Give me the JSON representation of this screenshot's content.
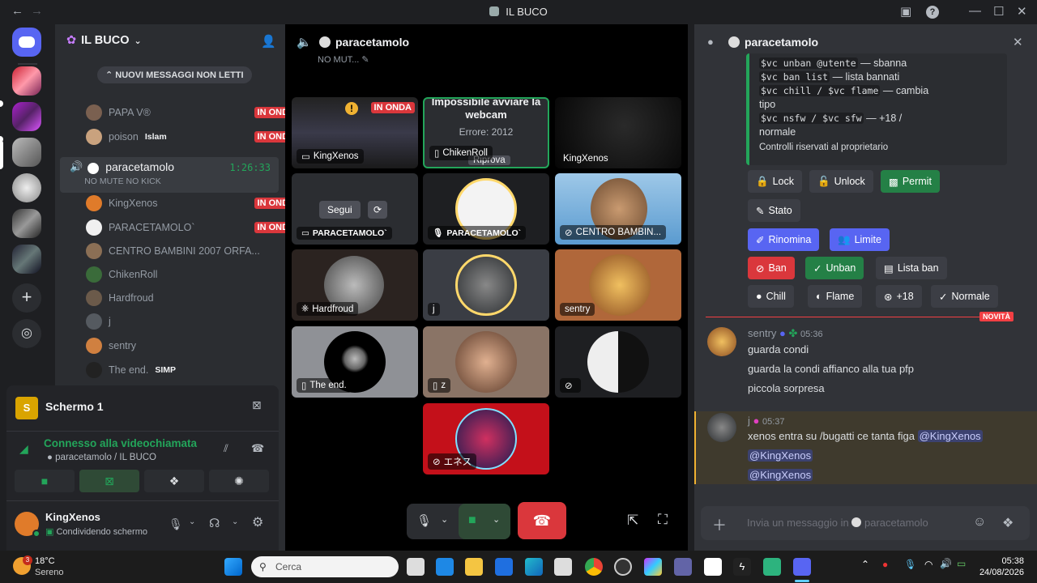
{
  "window": {
    "title": "IL BUCO"
  },
  "server": {
    "name": "IL BUCO"
  },
  "banner": {
    "new_messages": "NUOVI MESSAGGI NON LETTI"
  },
  "live_label": "IN ONDA",
  "voice_members": [
    {
      "name": "PAPA V®",
      "live": true,
      "color": "#7a6050"
    },
    {
      "name": "poison",
      "tag": "Islam",
      "live": true,
      "color": "#c9a27e"
    },
    {
      "name": "paracetamolo",
      "sub": "NO MUTE NO KICK",
      "timer": "1:26:33",
      "color": "#ffffff"
    },
    {
      "name": "KingXenos",
      "live": true,
      "color": "#e07b2a"
    },
    {
      "name": "PARACETAMOLO`",
      "live": true,
      "color": "#f0f0f0"
    },
    {
      "name": "CENTRO BAMBINI 2007 ORFA...",
      "color": "#8b6f55"
    },
    {
      "name": "ChikenRoll",
      "color": "#3a6b3a"
    },
    {
      "name": "Hardfroud",
      "color": "#6b5a4a"
    },
    {
      "name": "j",
      "color": "#555a60"
    },
    {
      "name": "sentry",
      "color": "#d08040"
    },
    {
      "name": "The end.",
      "tag": "SIMP",
      "color": "#222222"
    },
    {
      "name": "z",
      "color": "#8a7060"
    }
  ],
  "screen_share": {
    "title": "Schermo 1",
    "app_letter": "S"
  },
  "connection": {
    "status": "Connesso alla videochiamata",
    "location": "paracetamolo / IL BUCO"
  },
  "user": {
    "name": "KingXenos",
    "status": "Condividendo schermo"
  },
  "stage": {
    "channel": "paracetamolo",
    "topic": "NO MUT...",
    "follow": "Segui",
    "retry": "Riprova",
    "error_title": "Impossibile avviare la webcam",
    "error_code": "Errore: 2012"
  },
  "tiles": [
    {
      "name": "KingXenos",
      "live": true
    },
    {
      "name": "ChikenRoll"
    },
    {
      "name": "KingXenos"
    },
    {
      "name": "PARACETAMOLO`"
    },
    {
      "name": "PARACETAMOLO`"
    },
    {
      "name": "CENTRO BAMBIN..."
    },
    {
      "name": "Hardfroud"
    },
    {
      "name": "j"
    },
    {
      "name": "sentry"
    },
    {
      "name": "The end."
    },
    {
      "name": "z"
    },
    {
      "name": ""
    },
    {
      "name": "エネス"
    }
  ],
  "chat": {
    "channel": "paracetamolo",
    "embed_lines": [
      {
        "code": "$vc unban @utente",
        "text": " — sbanna"
      },
      {
        "code": "$vc ban list",
        "text": " — lista bannati"
      },
      {
        "code": "$vc chill / $vc flame",
        "text": " — cambia"
      },
      {
        "code": "",
        "text": "tipo"
      },
      {
        "code": "$vc nsfw / $vc sfw",
        "text": " — +18 /"
      },
      {
        "code": "",
        "text": "normale"
      }
    ],
    "embed_footer": "Controlli riservati al proprietario",
    "buttons": {
      "lock": "Lock",
      "unlock": "Unlock",
      "permit": "Permit",
      "stato": "Stato",
      "rinomina": "Rinomina",
      "limite": "Limite",
      "ban": "Ban",
      "unban": "Unban",
      "lista_ban": "Lista ban",
      "chill": "Chill",
      "flame": "Flame",
      "plus18": "+18",
      "normale": "Normale"
    },
    "new_badge": "NOVITÀ",
    "messages": [
      {
        "author": "sentry",
        "time": "05:36",
        "lines": [
          "guarda condi",
          "guarda la condi affianco alla tua pfp",
          "piccola sorpresa"
        ]
      },
      {
        "author": "j",
        "time": "05:37",
        "text": "xenos entra su /bugatti ce tanta figa",
        "mentions": [
          "@KingXenos",
          "@KingXenos",
          "@KingXenos"
        ]
      }
    ],
    "input_placeholder": "Invia un messaggio in",
    "input_channel": "paracetamolo"
  },
  "taskbar": {
    "temp": "18°C",
    "weather": "Sereno",
    "search": "Cerca",
    "time": "05:38",
    "date": "24/08/2026",
    "badge": "3"
  }
}
